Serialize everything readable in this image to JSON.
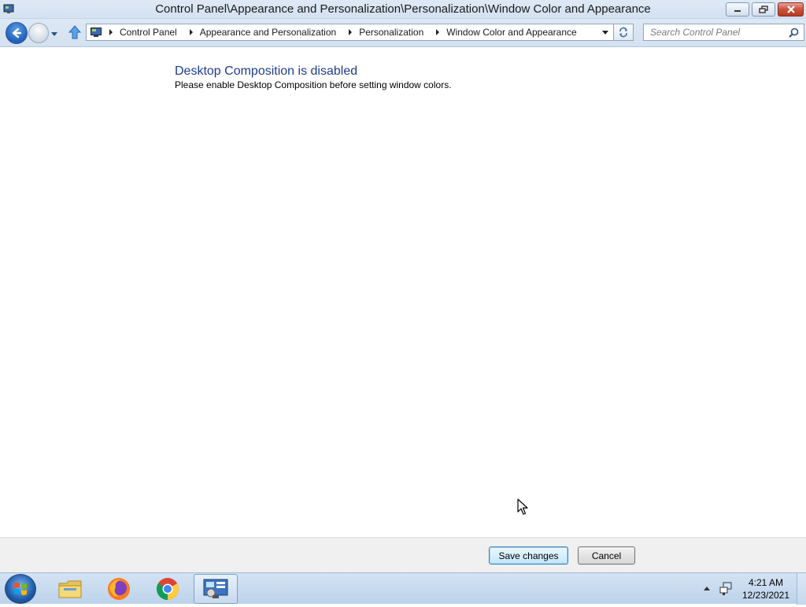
{
  "window": {
    "title": "Control Panel\\Appearance and Personalization\\Personalization\\Window Color and Appearance",
    "controls": [
      "minimize-icon",
      "restore-icon",
      "close-icon"
    ]
  },
  "navigation": {
    "breadcrumbs": [
      "Control Panel",
      "Appearance and Personalization",
      "Personalization",
      "Window Color and Appearance"
    ],
    "search": {
      "placeholder": "Search Control Panel",
      "value": ""
    }
  },
  "content": {
    "heading": "Desktop Composition is disabled",
    "message": "Please enable Desktop Composition before setting window colors."
  },
  "footer": {
    "save_label": "Save changes",
    "cancel_label": "Cancel"
  },
  "taskbar": {
    "items": [
      "windows-start-icon",
      "file-explorer-icon",
      "firefox-icon",
      "chrome-icon",
      "control-panel-icon"
    ],
    "active_item": "control-panel-icon",
    "clock": {
      "time": "4:21 AM",
      "date": "12/23/2021"
    }
  },
  "colors": {
    "heading": "#1e3d8f",
    "titlebar": "#d3e1f1",
    "save_button_border": "#3c7fb1"
  }
}
